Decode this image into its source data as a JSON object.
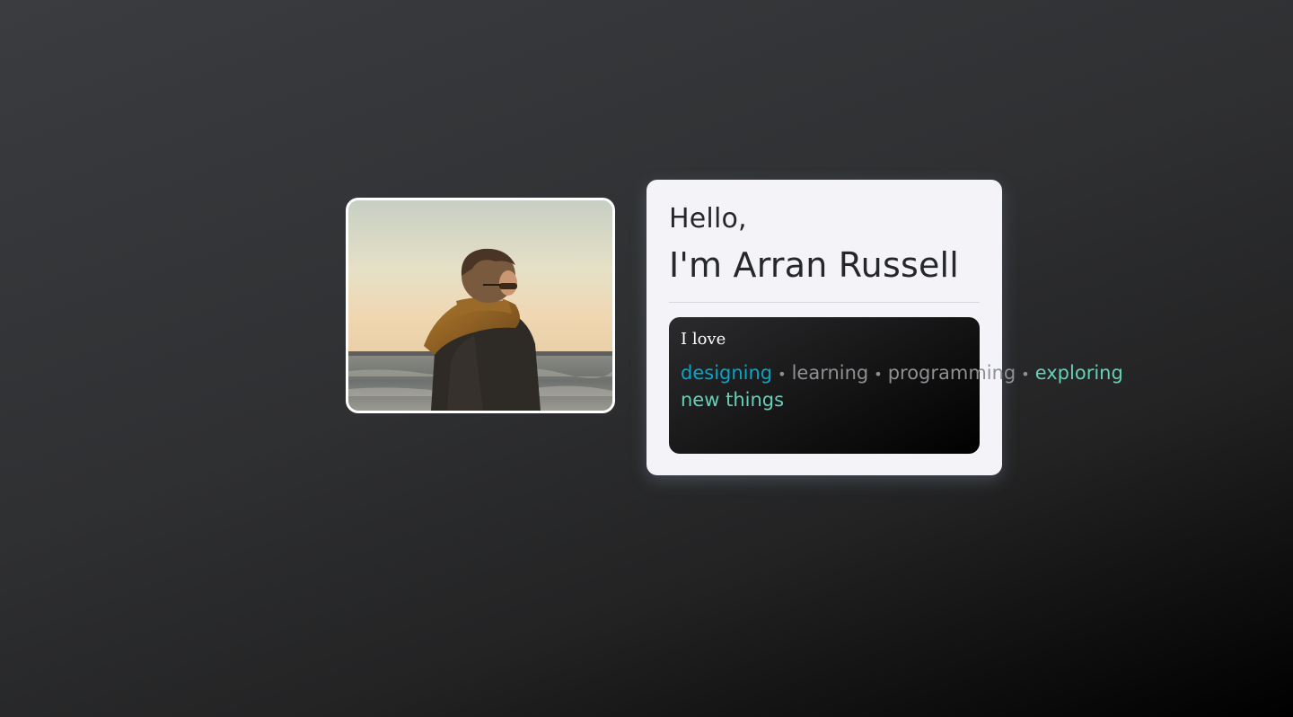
{
  "profile": {
    "photo_alt": "profile-photo",
    "greeting": "Hello,",
    "name": "I'm Arran Russell"
  },
  "interests": {
    "label": "I love",
    "separator": "•",
    "items": [
      {
        "text": "designing",
        "color": "#0aa4c4"
      },
      {
        "text": "learning",
        "color": "#8f9093"
      },
      {
        "text": "programming",
        "color": "#8f9093"
      },
      {
        "text": "exploring new things",
        "color": "#66d0b6"
      }
    ]
  },
  "colors": {
    "card_background": "#f3f3f8",
    "text_dark": "#25272b",
    "accent_blue": "#0aa4c4",
    "accent_teal": "#66d0b6"
  }
}
